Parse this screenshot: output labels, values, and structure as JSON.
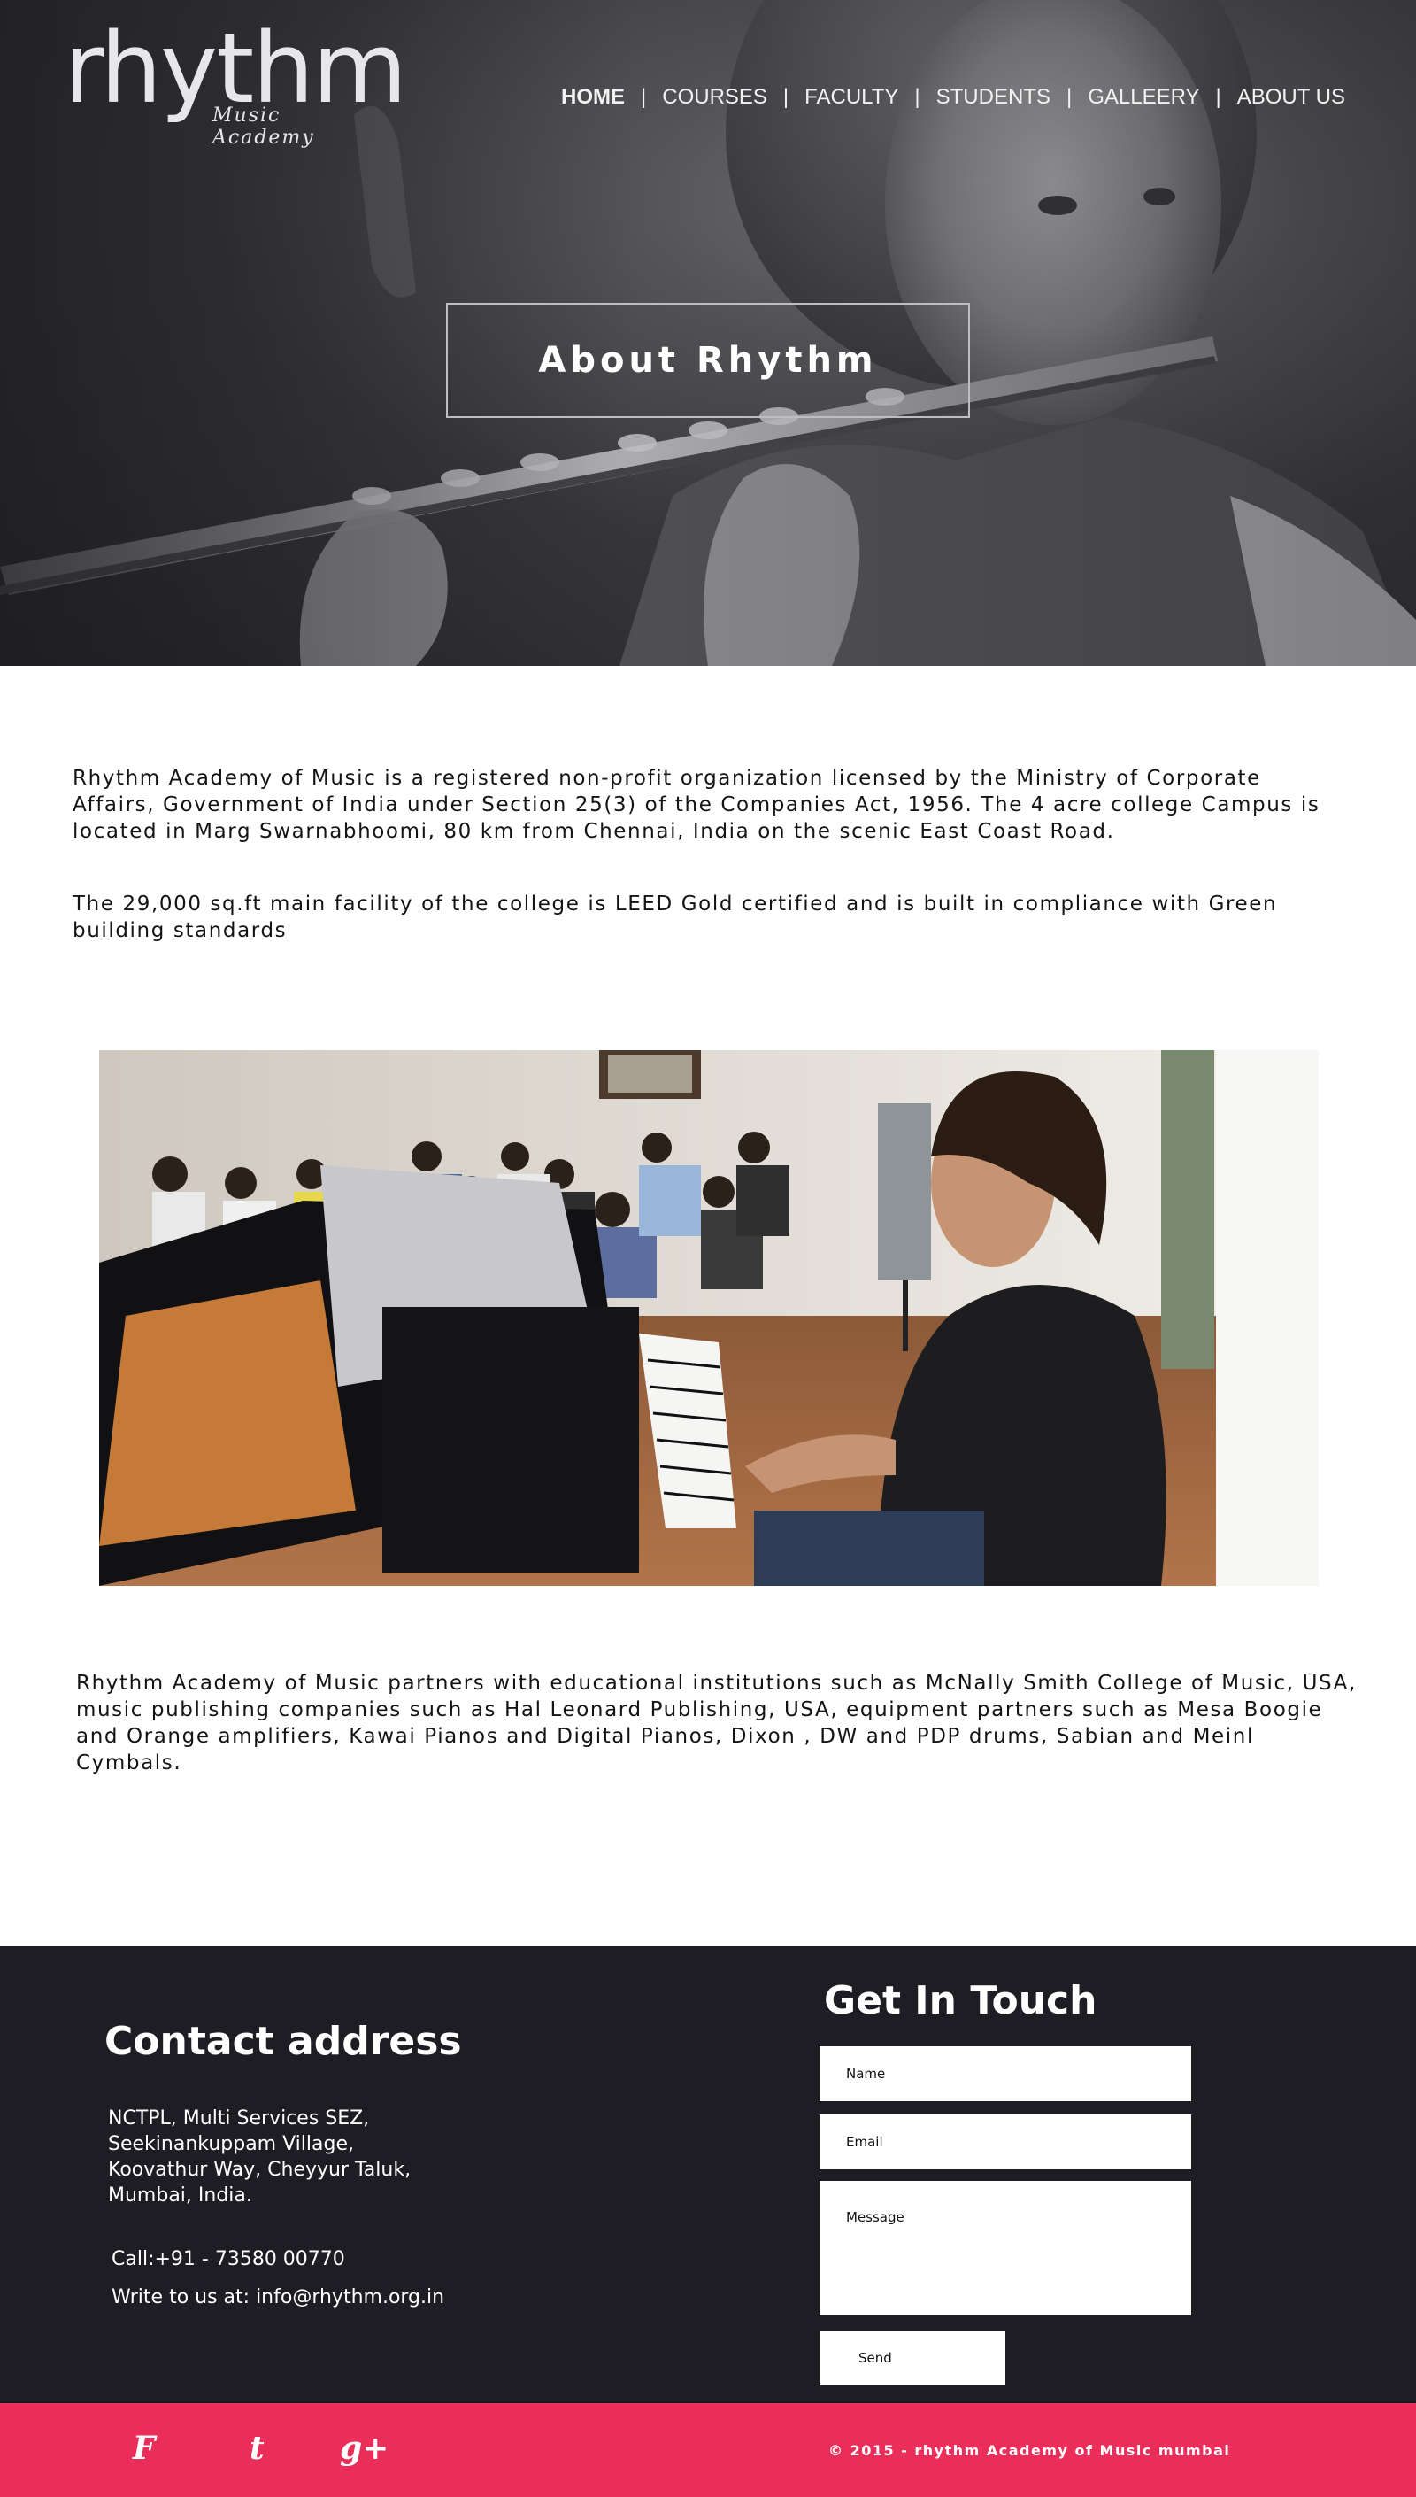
{
  "logo": {
    "word": "rhythm",
    "sub": "Music Academy"
  },
  "nav": {
    "items": [
      {
        "label": "HOME",
        "active": true
      },
      {
        "label": "COURSES"
      },
      {
        "label": "FACULTY"
      },
      {
        "label": "STUDENTS"
      },
      {
        "label": "GALLEERY"
      },
      {
        "label": "ABOUT US"
      }
    ],
    "separator": "|"
  },
  "hero": {
    "title": "About Rhythm"
  },
  "content": {
    "paragraph1": "Rhythm Academy of Music is a registered non-profit organization licensed by the Ministry of Corporate Affairs, Government of India under Section 25(3) of the Companies Act, 1956. The 4 acre college Campus is located in Marg Swarnabhoomi, 80 km from Chennai, India on the scenic East Coast Road.",
    "paragraph2": "The 29,000 sq.ft main facility of the college is LEED Gold certified and is built in  compliance with Green building standards",
    "paragraph3": "Rhythm Academy of Music partners with educational institutions such as McNally Smith College of Music, USA, music publishing companies such as Hal Leonard Publishing, USA, equipment partners such as Mesa Boogie and Orange amplifiers, Kawai Pianos and Digital Pianos, Dixon , DW and PDP drums, Sabian and Meinl Cymbals."
  },
  "footer": {
    "contact_title": "Contact address",
    "address": [
      "NCTPL, Multi Services SEZ,",
      "Seekinankuppam Village,",
      "Koovathur Way, Cheyyur Taluk,",
      "Mumbai, India."
    ],
    "call": "Call:+91 - 73580 00770",
    "write": "Write to us at: info@rhythm.org.in",
    "form_title": "Get In Touch",
    "name_placeholder": "Name",
    "email_placeholder": "Email",
    "message_placeholder": "Message",
    "send_label": "Send"
  },
  "bottombar": {
    "social": {
      "facebook": "F",
      "twitter": "t",
      "googleplus": "g+"
    },
    "copyright": "© 2015 - rhythm Academy of Music mumbai"
  },
  "colors": {
    "footer_bg": "#1e1d23",
    "bottombar_bg": "#ea2d59",
    "hero_bg": "#4a4a4e"
  }
}
